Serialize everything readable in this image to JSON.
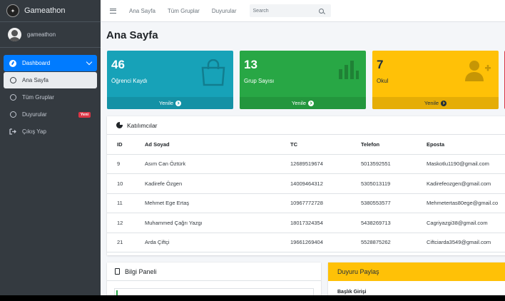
{
  "brand": {
    "name": "Gameathon"
  },
  "user": {
    "name": "gameathon"
  },
  "sidebar": {
    "items": [
      {
        "label": "Dashboard"
      },
      {
        "label": "Ana Sayfa"
      },
      {
        "label": "Tüm Gruplar"
      },
      {
        "label": "Duyurular",
        "badge": "Yeni"
      },
      {
        "label": "Çıkış Yap"
      }
    ]
  },
  "topnav": {
    "links": [
      "Ana Sayfa",
      "Tüm Gruplar",
      "Duyurular"
    ],
    "search_placeholder": "Search"
  },
  "page": {
    "title": "Ana Sayfa"
  },
  "stats": [
    {
      "value": "46",
      "label": "Öğrenci Kaydı",
      "footer": "Yenile",
      "color": "#17a2b8",
      "icon": "shopping-bag-icon"
    },
    {
      "value": "13",
      "label": "Grup Sayısı",
      "footer": "Yenile",
      "color": "#28a745",
      "icon": "bar-chart-icon"
    },
    {
      "value": "7",
      "label": "Okul",
      "footer": "Yenile",
      "color": "#ffc107",
      "icon": "user-plus-icon"
    }
  ],
  "participants": {
    "title": "Katılımcılar",
    "columns": [
      "ID",
      "Ad Soyad",
      "TC",
      "Telefon",
      "Eposta"
    ],
    "rows": [
      [
        "9",
        "Asım Can Öztürk",
        "12689519674",
        "5013592551",
        "Maskotlu1190@gmail.com"
      ],
      [
        "10",
        "Kadirefe Özgen",
        "14009464312",
        "5305013119",
        "Kadirefeozgen@gmail.com"
      ],
      [
        "11",
        "Mehmet Ege Ertaş",
        "10967772728",
        "5380553577",
        "Mehmetertas80ege@gmail.co"
      ],
      [
        "12",
        "Muhammed Çağrı Yazgı",
        "18017324354",
        "5438269713",
        "Cagriyazgi38@gmail.com"
      ],
      [
        "21",
        "Arda Çiftçi",
        "19661269404",
        "5528875262",
        "Ciftciarda3549@gmail.com"
      ]
    ]
  },
  "info_panel": {
    "title": "Bilgi Paneli"
  },
  "share_panel": {
    "title": "Duyuru Paylaş",
    "field_label": "Başlık Girişi"
  }
}
